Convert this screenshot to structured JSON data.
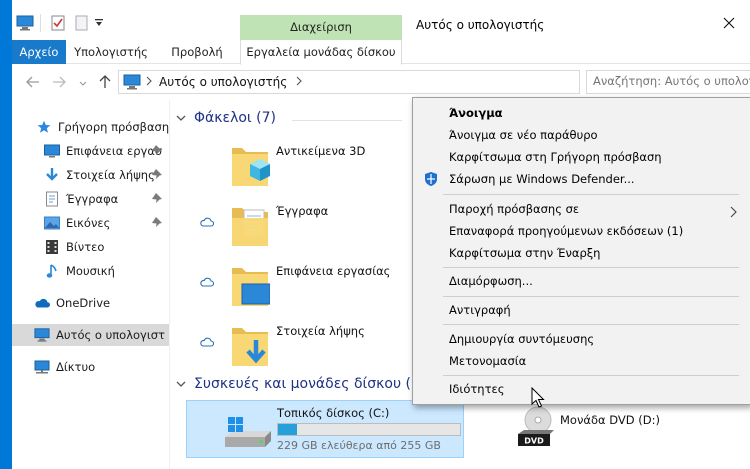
{
  "window": {
    "title": "Αυτός ο υπολογιστής"
  },
  "ribbon": {
    "contextual_group": "Διαχείριση",
    "tabs": [
      "Αρχείο",
      "Υπολογιστής",
      "Προβολή",
      "Εργαλεία μονάδας δίσκου"
    ]
  },
  "address": {
    "path": "Αυτός ο υπολογιστής",
    "search_placeholder": "Αναζήτηση: Αυτός ο υπολογ..."
  },
  "sidebar": {
    "items": [
      {
        "label": "Γρήγορη πρόσβαση",
        "icon": "star-icon"
      },
      {
        "label": "Επιφάνεια εργασ",
        "icon": "desktop-icon",
        "pinned": true
      },
      {
        "label": "Στοιχεία λήψης",
        "icon": "download-icon",
        "pinned": true
      },
      {
        "label": "Έγγραφα",
        "icon": "document-icon",
        "pinned": true
      },
      {
        "label": "Εικόνες",
        "icon": "pictures-icon",
        "pinned": true
      },
      {
        "label": "Βίντεο",
        "icon": "video-icon"
      },
      {
        "label": "Μουσική",
        "icon": "music-icon"
      },
      {
        "label": "OneDrive",
        "icon": "onedrive-icon"
      },
      {
        "label": "Αυτός ο υπολογιστ",
        "icon": "computer-icon",
        "selected": true
      },
      {
        "label": "Δίκτυο",
        "icon": "network-icon"
      }
    ]
  },
  "content": {
    "folders_header": "Φάκελοι (7)",
    "folders": [
      {
        "label": "Αντικείμενα 3D",
        "icon": "objects-3d-folder-icon",
        "cloud": false
      },
      {
        "label": "Έγγραφα",
        "icon": "documents-folder-icon",
        "cloud": true
      },
      {
        "label": "Επιφάνεια εργασίας",
        "icon": "desktop-folder-icon",
        "cloud": true
      },
      {
        "label": "Στοιχεία λήψης",
        "icon": "downloads-folder-icon",
        "cloud": true
      }
    ],
    "devices_header": "Συσκευές και μονάδες δίσκου (",
    "drives": [
      {
        "label": "Τοπικός δίσκος (C:)",
        "free_text": "229 GB ελεύθερα από 255 GB",
        "used_fraction": 0.102,
        "icon": "windows-drive-icon"
      },
      {
        "label": "Μονάδα DVD (D:)",
        "icon": "dvd-drive-icon"
      }
    ]
  },
  "context_menu": {
    "items": [
      {
        "label": "Άνοιγμα",
        "bold": true
      },
      {
        "label": "Άνοιγμα σε νέο παράθυρο"
      },
      {
        "label": "Καρφίτσωμα στη Γρήγορη πρόσβαση"
      },
      {
        "label": "Σάρωση με Windows Defender...",
        "icon": "windows-defender-icon"
      },
      {
        "label": "Παροχή πρόσβασης σε",
        "submenu": true
      },
      {
        "label": "Επαναφορά προηγούμενων εκδόσεων (1)"
      },
      {
        "label": "Καρφίτσωμα στην Έναρξη"
      },
      {
        "label": "Διαμόρφωση..."
      },
      {
        "label": "Αντιγραφή"
      },
      {
        "label": "Δημιουργία συντόμευσης"
      },
      {
        "label": "Μετονομασία"
      },
      {
        "label": "Ιδιότητες"
      }
    ]
  },
  "colors": {
    "accent": "#1979ca",
    "contextual_tab": "#bfe3b4",
    "group_header": "#1e3287",
    "selection": "#cce8ff",
    "drive_bar": "#26a0da"
  }
}
